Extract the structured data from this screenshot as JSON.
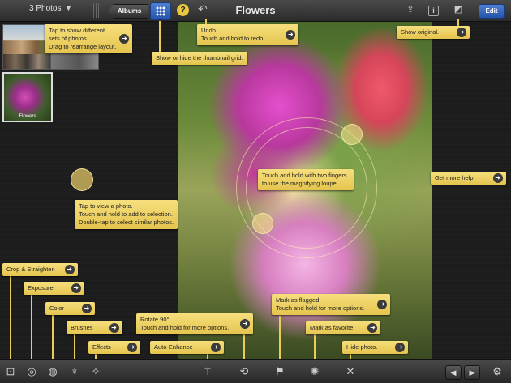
{
  "topbar": {
    "photos_count": "3 Photos",
    "albums_label": "Albums",
    "title": "Flowers",
    "edit_label": "Edit",
    "help_glyph": "?",
    "info_glyph": "i"
  },
  "thumbnails": [
    {
      "label": ""
    },
    {
      "label": "Flowers"
    }
  ],
  "callouts": {
    "sets": [
      "Tap to show different",
      "sets of photos.",
      "Drag to rearrange layout."
    ],
    "grid": [
      "Show or hide the thumbnail grid."
    ],
    "undo": [
      "Undo",
      "Touch and hold to redo."
    ],
    "original": [
      "Show original."
    ],
    "view": [
      "Tap to view a photo.",
      "Touch and hold to add to selection.",
      "Double-tap to select similar photos."
    ],
    "loupe": [
      "Touch and hold with two fingers",
      "to use the magnifying loupe."
    ],
    "help": [
      "Get more help."
    ],
    "crop": [
      "Crop & Straighten"
    ],
    "exposure": [
      "Exposure"
    ],
    "color": [
      "Color"
    ],
    "brushes": [
      "Brushes"
    ],
    "effects": [
      "Effects"
    ],
    "rotate": [
      "Rotate 90°.",
      "Touch and hold for more options."
    ],
    "enhance": [
      "Auto-Enhance"
    ],
    "flag": [
      "Mark as flagged.",
      "Touch and hold for more options."
    ],
    "favorite": [
      "Mark as favorite."
    ],
    "hide": [
      "Hide photo."
    ]
  },
  "arrow_glyph": "➜",
  "icons": {
    "crop": "crop-icon",
    "exposure": "exposure-icon",
    "color": "palette-icon",
    "brushes": "brush-icon",
    "effects": "effects-icon",
    "enhance": "magic-wand-icon",
    "rotate": "rotate-icon",
    "flag": "flag-icon",
    "favorite": "favorite-icon",
    "hide": "hide-icon",
    "prev": "arrow-left-icon",
    "next": "arrow-right-icon",
    "settings": "gear-icon"
  },
  "colors": {
    "callout": "#efd35e",
    "accent_blue": "#2f63c0",
    "bar_dark": "#2b2b2b"
  }
}
